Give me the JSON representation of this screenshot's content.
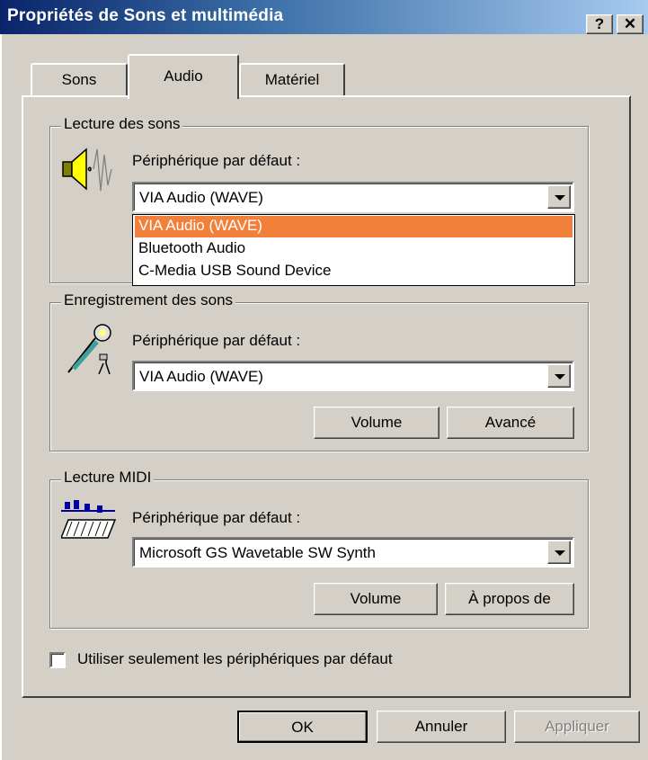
{
  "window": {
    "title": "Propriétés de Sons et multimédia",
    "help_glyph": "?",
    "close_glyph": "✕"
  },
  "tabs": [
    "Sons",
    "Audio",
    "Matériel"
  ],
  "active_tab": "Audio",
  "playback": {
    "legend": "Lecture des sons",
    "label": "Périphérique par défaut :",
    "selected": "VIA Audio (WAVE)",
    "icon": "speaker-icon",
    "options": [
      "VIA Audio (WAVE)",
      "Bluetooth Audio",
      "C-Media USB Sound Device"
    ],
    "highlighted_option": "VIA Audio (WAVE)",
    "highlight_color": "#f0803a"
  },
  "recording": {
    "legend": "Enregistrement des sons",
    "label": "Périphérique par défaut :",
    "selected": "VIA Audio (WAVE)",
    "icon": "microphone-icon",
    "volume_label": "Volume",
    "advanced_label": "Avancé"
  },
  "midi": {
    "legend": "Lecture MIDI",
    "label": "Périphérique par défaut :",
    "selected": "Microsoft GS Wavetable SW Synth",
    "icon": "midi-keyboard-icon",
    "volume_label": "Volume",
    "about_label": "À propos de"
  },
  "default_only": {
    "label": "Utiliser seulement les périphériques par défaut",
    "checked": false
  },
  "footer": {
    "ok": "OK",
    "cancel": "Annuler",
    "apply": "Appliquer"
  }
}
